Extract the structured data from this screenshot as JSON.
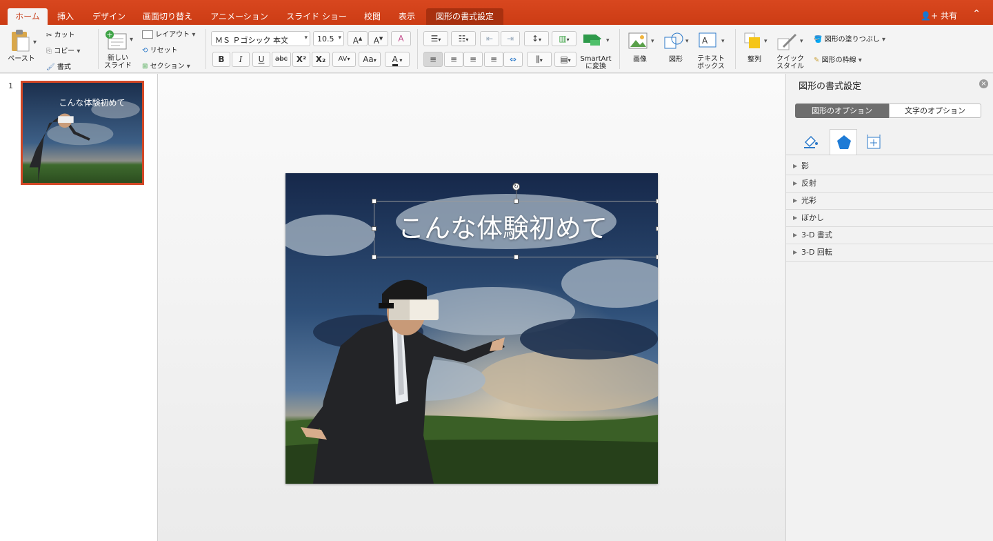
{
  "tabs": [
    {
      "label": "ホーム",
      "active": true
    },
    {
      "label": "挿入"
    },
    {
      "label": "デザイン"
    },
    {
      "label": "画面切り替え"
    },
    {
      "label": "アニメーション"
    },
    {
      "label": "スライド ショー"
    },
    {
      "label": "校閲"
    },
    {
      "label": "表示"
    },
    {
      "label": "図形の書式設定",
      "contextual": true
    }
  ],
  "share_label": "共有",
  "clipboard": {
    "paste": "ペースト",
    "cut": "カット",
    "copy": "コピー",
    "format": "書式"
  },
  "slides_group": {
    "new_slide": "新しい\nスライド",
    "layout": "レイアウト",
    "reset": "リセット",
    "section": "セクション"
  },
  "font": {
    "name": "ＭＳ Ｐゴシック 本文",
    "size": "10.5"
  },
  "format_buttons": {
    "bold": "B",
    "italic": "I",
    "underline": "U",
    "strike": "abc",
    "superscript": "X²",
    "subscript": "X₂",
    "font_color": "A"
  },
  "insert_group": {
    "smartart": "SmartArt\nに変換",
    "picture": "画像",
    "shape": "図形",
    "textbox": "テキスト\nボックス"
  },
  "arrange_group": {
    "arrange": "整列",
    "quick_style": "クイック\nスタイル",
    "shape_fill": "図形の塗りつぶし",
    "shape_outline": "図形の枠線"
  },
  "thumbnail": {
    "number": "1",
    "title": "こんな体験初めて"
  },
  "slide": {
    "title": "こんな体験初めて"
  },
  "pane": {
    "title": "図形の書式設定",
    "option_tabs": [
      "図形のオプション",
      "文字のオプション"
    ],
    "sections": [
      "影",
      "反射",
      "光彩",
      "ぼかし",
      "3-D 書式",
      "3-D 回転"
    ]
  },
  "colors": {
    "accent": "#d24726",
    "pane_tab_selected": "#6e6e6e",
    "icon_blue": "#1e7bd6"
  }
}
